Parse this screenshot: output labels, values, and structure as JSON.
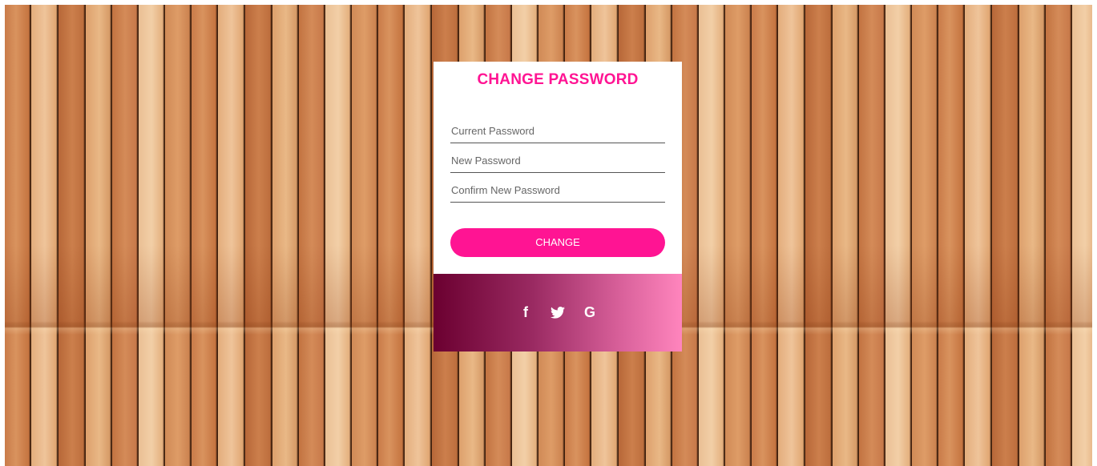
{
  "form": {
    "title": "CHANGE PASSWORD",
    "fields": [
      {
        "placeholder": "Current Password"
      },
      {
        "placeholder": "New Password"
      },
      {
        "placeholder": "Confirm New Password"
      }
    ],
    "submit_label": "CHANGE"
  },
  "social": {
    "facebook_glyph": "f",
    "twitter_icon": "twitter-icon",
    "google_glyph": "G"
  },
  "colors": {
    "accent": "#ff1493",
    "footer_gradient_start": "#6b0030",
    "footer_gradient_end": "#ff85bd"
  }
}
